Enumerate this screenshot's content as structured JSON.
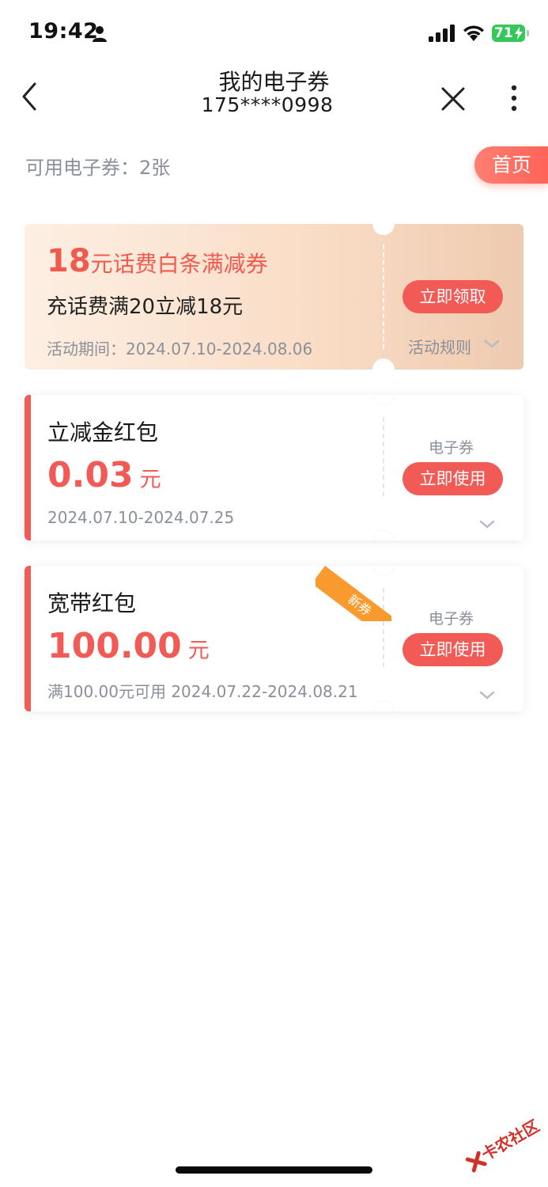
{
  "status_bar": {
    "time": "19:42",
    "battery": "71"
  },
  "nav": {
    "title": "我的电子券",
    "subtitle": "175****0998"
  },
  "summary": {
    "label": "可用电子券：2张",
    "home_button": "首页"
  },
  "coupons": [
    {
      "title_amount": "18",
      "title_rest": "元话费白条满减券",
      "description": "充话费满20立减18元",
      "period": "活动期间：2024.07.10-2024.08.06",
      "button": "立即领取",
      "rules": "活动规则"
    },
    {
      "title": "立减金红包",
      "amount": "0.03",
      "unit": "元",
      "meta": "2024.07.10-2024.07.25",
      "type": "电子券",
      "button": "立即使用"
    },
    {
      "title": "宽带红包",
      "amount": "100.00",
      "unit": "元",
      "meta": "满100.00元可用 2024.07.22-2024.08.21",
      "type": "电子券",
      "button": "立即使用",
      "badge": "新券"
    }
  ],
  "watermark": "卡农社区",
  "colors": {
    "accent": "#f25a55",
    "badge": "#f99a2e",
    "battery": "#34c759"
  }
}
